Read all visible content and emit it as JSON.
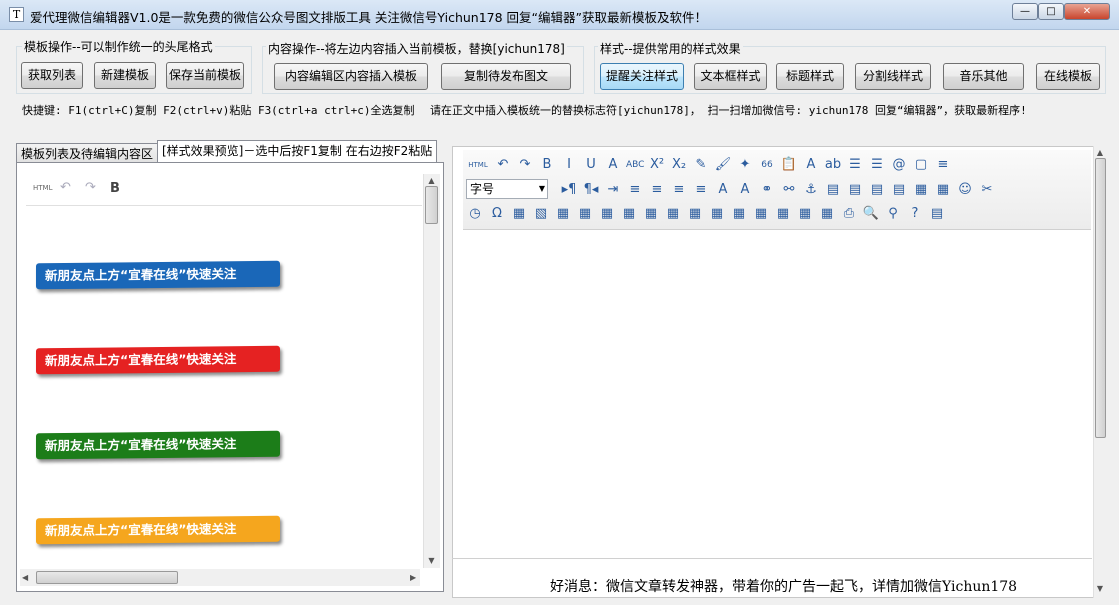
{
  "window": {
    "title": "爱代理微信编辑器V1.0是一款免费的微信公众号图文排版工具 关注微信号Yichun178 回复“编辑器”获取最新模板及软件！",
    "icon_letter": "T",
    "minimize": "—",
    "maximize": "□",
    "close": "✕"
  },
  "template_group": {
    "label": "模板操作--可以制作统一的头尾格式",
    "buttons": [
      "获取列表",
      "新建模板",
      "保存当前模板"
    ]
  },
  "content_group": {
    "label": "内容操作--将左边内容插入当前模板，替换[yichun178]",
    "buttons": [
      "内容编辑区内容插入模板",
      "复制待发布图文"
    ]
  },
  "style_group": {
    "label": "样式--提供常用的样式效果",
    "buttons": [
      "提醒关注样式",
      "文本框样式",
      "标题样式",
      "分割线样式",
      "音乐其他",
      "在线模板"
    ],
    "active_index": 0
  },
  "hints": {
    "shortcuts": "快捷键: F1(ctrl+C)复制  F2(ctrl+v)粘贴 F3(ctrl+a ctrl+c)全选复制",
    "notice": "请在正文中插入模板统一的替换标志符[yichun178]， 扫一扫增加微信号: yichun178 回复“编辑器”，获取最新程序!"
  },
  "tabs": {
    "tab1": "模板列表及待编辑内容区",
    "tab2": "[样式效果预览]－选中后按F1复制 在右边按F2粘贴"
  },
  "preview": {
    "mini_toolbar": {
      "html": "HTML",
      "undo": "↶",
      "redo": "↷",
      "bold": "B"
    },
    "banners": [
      {
        "text": "新朋友点上方“宜春在线”快速关注",
        "color": "#1a67b8"
      },
      {
        "text": "新朋友点上方“宜春在线”快速关注",
        "color": "#e52222"
      },
      {
        "text": "新朋友点上方“宜春在线”快速关注",
        "color": "#1c7d19"
      },
      {
        "text": "新朋友点上方“宜春在线”快速关注",
        "color": "#f5a61e"
      }
    ]
  },
  "editor": {
    "font_select": "字号",
    "toolbar_row1": [
      "HTML",
      "↶",
      "↷",
      "B",
      "I",
      "U",
      "A",
      "ABC",
      "X²",
      "X₂",
      "✎",
      "🖌",
      "✦",
      "66",
      "📋",
      "A",
      "ab",
      "☰",
      "☰",
      "@",
      "▢",
      "≡"
    ],
    "toolbar_row2": [
      "▸¶",
      "¶◂",
      "⇥",
      "≡",
      "≡",
      "≡",
      "≡",
      "A",
      "A",
      "⚭",
      "⚯",
      "⚓",
      "▤",
      "▤",
      "▤",
      "▤",
      "▦",
      "▦",
      "☺",
      "✂"
    ],
    "toolbar_row3": [
      "◷",
      "Ω",
      "▦",
      "▧",
      "▦",
      "▦",
      "▦",
      "▦",
      "▦",
      "▦",
      "▦",
      "▦",
      "▦",
      "▦",
      "▦",
      "▦",
      "▦",
      "⎙",
      "🔍",
      "⚲",
      "?",
      "▤"
    ],
    "marquee": "好消息：微信文章转发神器，带着你的广告一起飞，详情加微信Yichun178"
  },
  "colors": {
    "title_bar": "#c2d6ee",
    "active_button": "#a7d9f5"
  }
}
